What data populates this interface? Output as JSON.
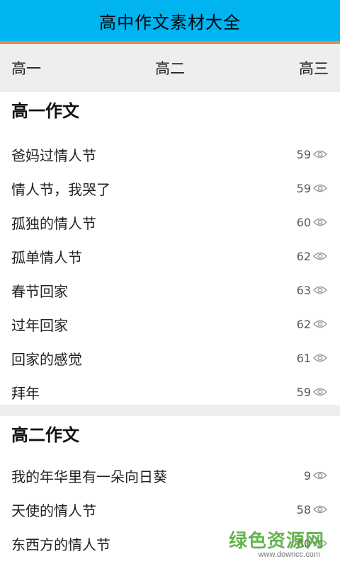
{
  "app": {
    "title": "高中作文素材大全"
  },
  "tabs": [
    {
      "label": "高一"
    },
    {
      "label": "高二"
    },
    {
      "label": "高三"
    }
  ],
  "sections": [
    {
      "title": "高一作文",
      "items": [
        {
          "title": "爸妈过情人节",
          "count": "59"
        },
        {
          "title": "情人节，我哭了",
          "count": "59"
        },
        {
          "title": "孤独的情人节",
          "count": "60"
        },
        {
          "title": "孤单情人节",
          "count": "62"
        },
        {
          "title": "春节回家",
          "count": "63"
        },
        {
          "title": "过年回家",
          "count": "62"
        },
        {
          "title": "回家的感觉",
          "count": "61"
        },
        {
          "title": "拜年",
          "count": "59"
        }
      ]
    },
    {
      "title": "高二作文",
      "items": [
        {
          "title": "我的年华里有一朵向日葵",
          "count": "9"
        },
        {
          "title": "天使的情人节",
          "count": "58"
        },
        {
          "title": "东西方的情人节",
          "count": "60"
        }
      ]
    }
  ],
  "watermark": {
    "text": "绿色资源网",
    "url": "www.downcc.com"
  },
  "colors": {
    "appbar": "#00b4f0",
    "accent": "#f08a2c",
    "tab_bg": "#eeeeee",
    "watermark": "#4aa832"
  },
  "icons": {
    "view_count": "eye-icon"
  }
}
